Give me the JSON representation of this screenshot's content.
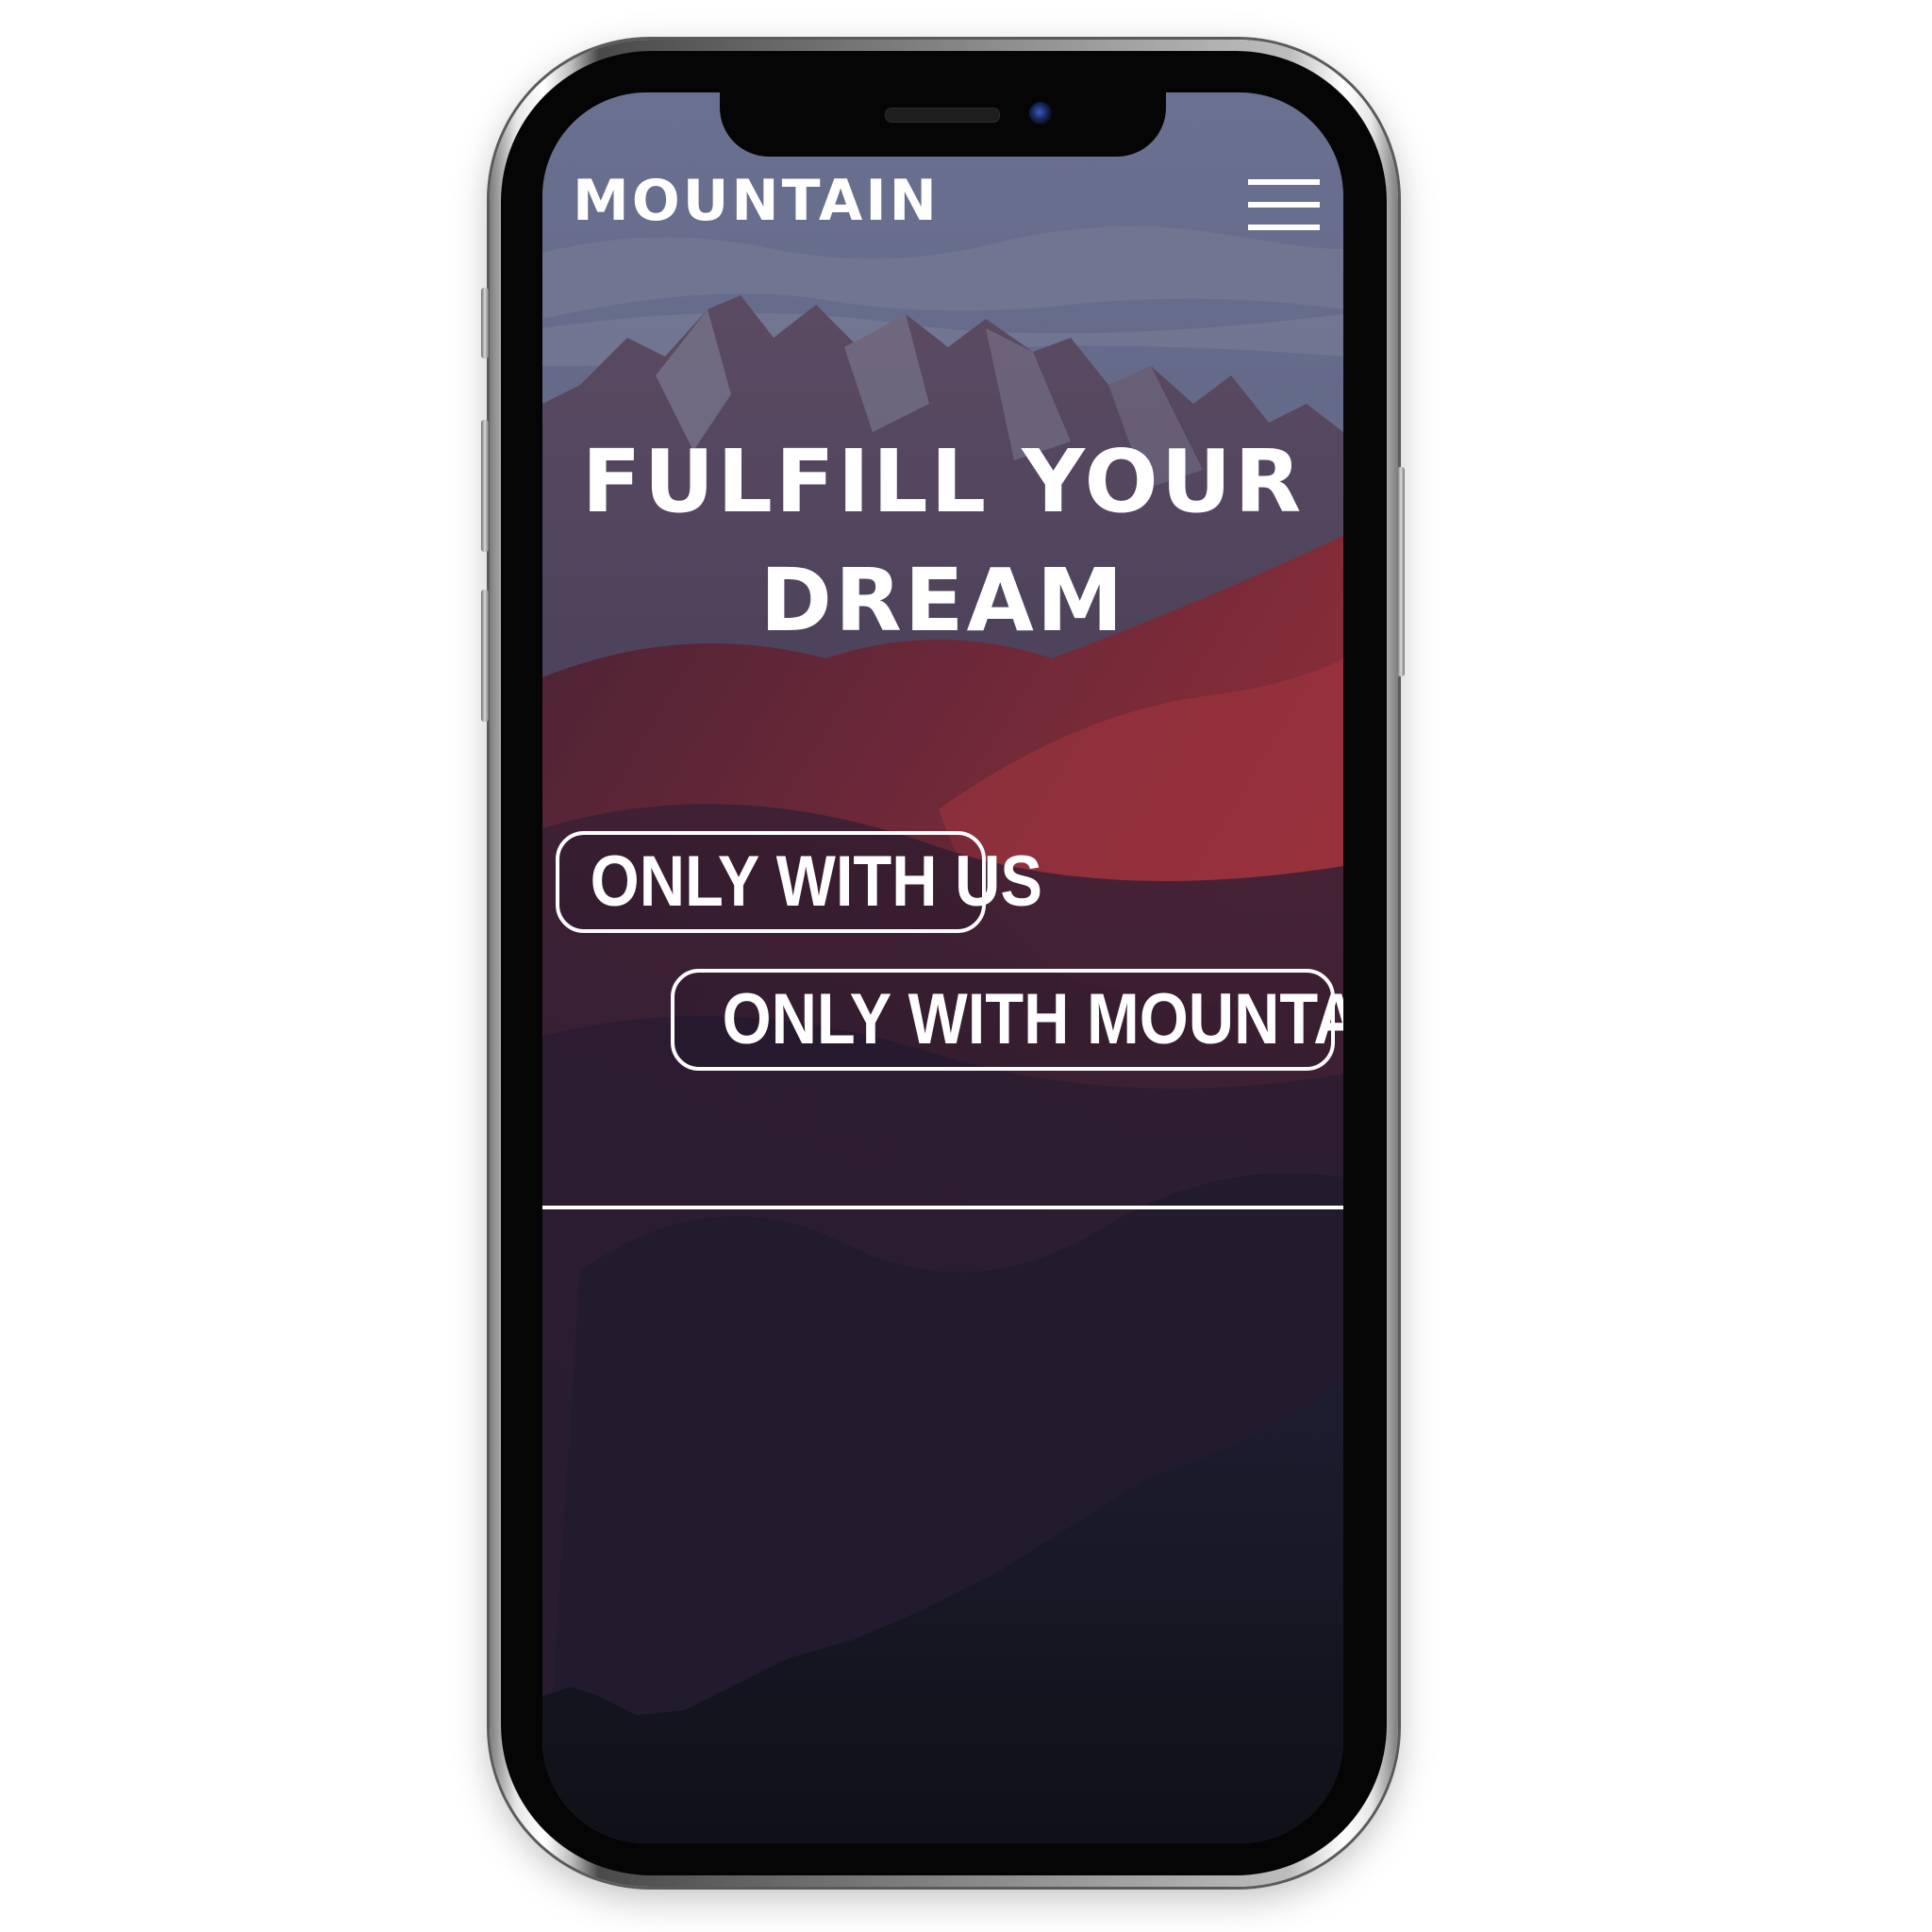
{
  "app": {
    "brand": "MOUNTAIN"
  },
  "header": {
    "menu_icon": "hamburger-menu-icon"
  },
  "hero": {
    "headline_line1": "FULFILL YOUR",
    "headline_line2": "DREAM",
    "cta_primary": "ONLY WITH US",
    "cta_secondary": "ONLY WITH MOUNTAIN"
  },
  "colors": {
    "text": "#ffffff",
    "sky": "#5f6582",
    "mountain_red": "#8a2a36",
    "mountain_dark": "#1a1c2e",
    "phone_frame": "#050505"
  }
}
